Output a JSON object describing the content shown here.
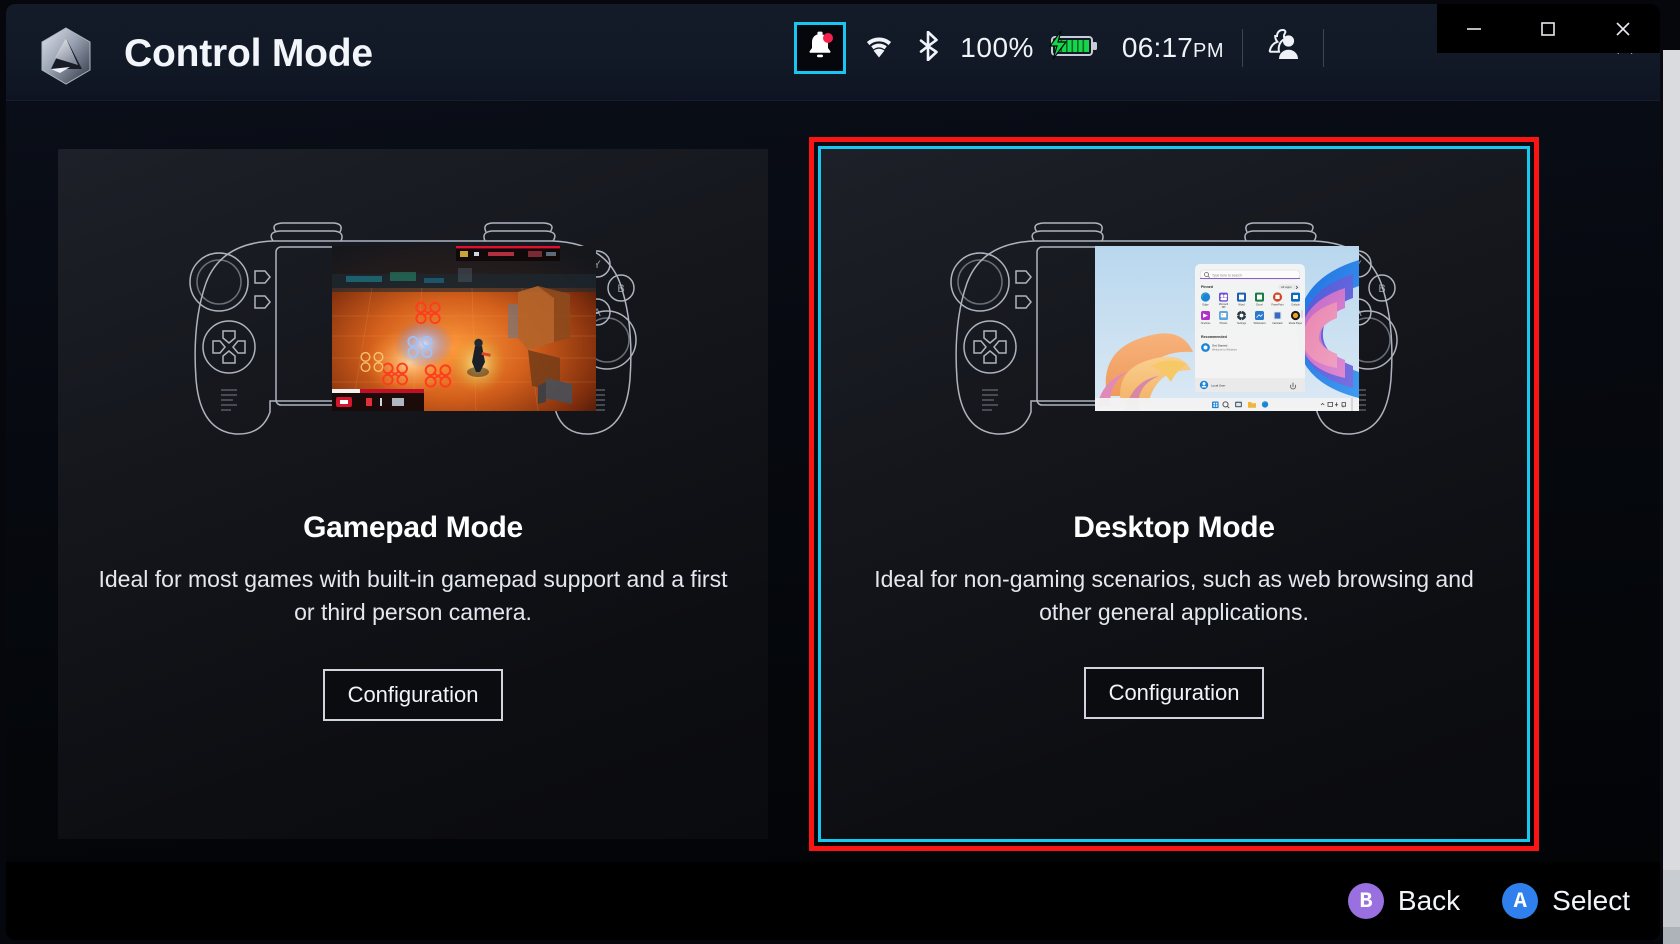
{
  "window": {
    "title": "Control Mode",
    "logo_icon": "armoury-crate-hex-logo"
  },
  "statusbar": {
    "notification_icon": "bell-icon",
    "notification_badge": "unread-dot",
    "wifi_icon": "wifi-icon",
    "bluetooth_icon": "bluetooth-icon",
    "battery_percent": "100%",
    "battery_icon": "battery-charging-icon",
    "time": "06:17",
    "time_period": "PM",
    "user_icon": "user-profile-icon",
    "focus_color": "#19c6f0"
  },
  "app_window_controls": {
    "minimize_label": "–",
    "close_label": "✕"
  },
  "os_window_controls": {
    "minimize_icon": "minimize-icon",
    "maximize_icon": "maximize-icon",
    "close_icon": "close-icon"
  },
  "cards": [
    {
      "id": "gamepad",
      "title": "Gamepad Mode",
      "description": "Ideal for most games with built-in gamepad support and a first or third person camera.",
      "button_label": "Configuration",
      "device_icon": "handheld-console-outline",
      "screen_preview": "game-screenshot",
      "selected": false
    },
    {
      "id": "desktop",
      "title": "Desktop Mode",
      "description": "Ideal for non-gaming scenarios, such as web browsing and other general applications.",
      "button_label": "Configuration",
      "device_icon": "handheld-console-outline",
      "screen_preview": "windows-desktop-start-menu",
      "selected": true
    }
  ],
  "selection": {
    "outer_border_color": "#fb1414",
    "inner_border_color": "#19c6f0"
  },
  "desktop_preview": {
    "search_placeholder": "Type here to search",
    "pinned_label": "Pinned",
    "all_apps_label": "All apps",
    "recommended_label": "Recommended",
    "recommended_item_title": "Get Started",
    "recommended_item_sub": "Welcome to Windows",
    "user_name": "Local User"
  },
  "footer": {
    "buttons": [
      {
        "glyph": "B",
        "label": "Back",
        "color": "#9a6fe0",
        "icon": "gamepad-b-button-icon"
      },
      {
        "glyph": "A",
        "label": "Select",
        "color": "#2f80ed",
        "icon": "gamepad-a-button-icon"
      }
    ]
  },
  "scrollbar": {
    "track_color": "#c9ccd1",
    "thumb_color": "#d9dbdf"
  }
}
